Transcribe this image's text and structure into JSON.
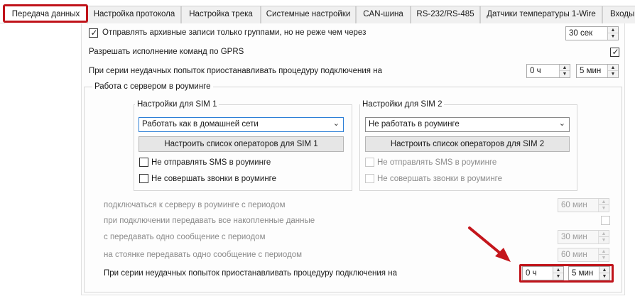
{
  "tabs": [
    {
      "label": "Передача данных"
    },
    {
      "label": "Настройка протокола"
    },
    {
      "label": "Настройка трека"
    },
    {
      "label": "Системные настройки"
    },
    {
      "label": "CAN-шина"
    },
    {
      "label": "RS-232/RS-485"
    },
    {
      "label": "Датчики температуры 1-Wire"
    },
    {
      "label": "Входы"
    }
  ],
  "general": {
    "archive_groups_label": "Отправлять архивные записи только группами, но не реже чем через",
    "archive_groups_value": "30 сек",
    "gprs_commands_label": "Разрешать исполнение команд по GPRS",
    "suspend_label": "При серии неудачных попыток приостанавливать процедуру подключения на",
    "suspend_hours": "0 ч",
    "suspend_minutes": "5 мин"
  },
  "roaming": {
    "title": "Работа с сервером в роуминге",
    "sim1": {
      "title": "Настройки для SIM 1",
      "mode": "Работать как в домашней сети",
      "operators_button": "Настроить список операторов для SIM 1",
      "no_sms_label": "Не отправлять SMS в роуминге",
      "no_calls_label": "Не совершать звонки в роуминге"
    },
    "sim2": {
      "title": "Настройки для SIM 2",
      "mode": "Не работать в роуминге",
      "operators_button": "Настроить список операторов для SIM 2",
      "no_sms_label": "Не отправлять SMS в роуминге",
      "no_calls_label": "Не совершать звонки в роуминге"
    },
    "connect_period_label": "подключаться к серверу в роуминге с периодом",
    "connect_period_value": "60 мин",
    "send_all_label": "при подключении передавать все накопленные данные",
    "send_one_label": "с передавать одно сообщение с периодом",
    "send_one_value": "30 мин",
    "parked_label": "на стоянке передавать одно сообщение с периодом",
    "parked_value": "60 мин",
    "suspend_label": "При серии неудачных попыток приостанавливать процедуру подключения на",
    "suspend_hours": "0 ч",
    "suspend_minutes": "5 мин"
  },
  "colors": {
    "highlight": "#c0131a",
    "arrow": "#c4161c"
  }
}
